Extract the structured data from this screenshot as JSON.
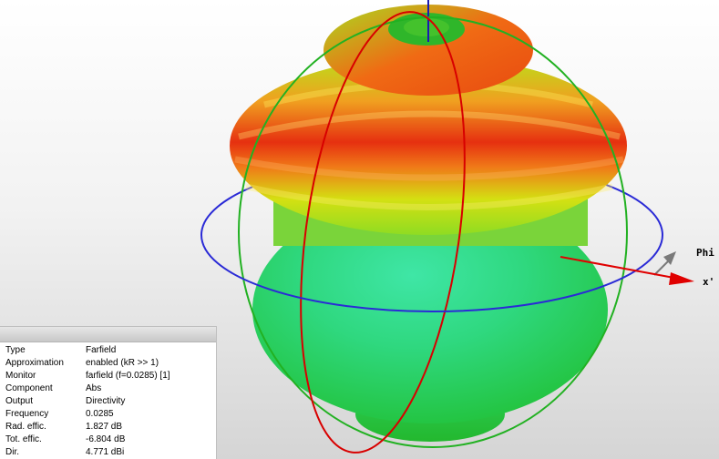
{
  "axes": {
    "phi_label": "Phi",
    "x_label": "x'"
  },
  "colors": {
    "phi_arrow": "#7a7a7a",
    "x_arrow": "#e00000",
    "ring_blue": "#2a2ad6",
    "ring_red": "#d80000",
    "ring_green": "#22b122"
  },
  "info": {
    "rows": [
      {
        "key": "Type",
        "value": "Farfield"
      },
      {
        "key": "Approximation",
        "value": "enabled (kR >> 1)"
      },
      {
        "key": "Monitor",
        "value": "farfield (f=0.0285) [1]"
      },
      {
        "key": "Component",
        "value": "Abs"
      },
      {
        "key": "Output",
        "value": "Directivity"
      },
      {
        "key": "Frequency",
        "value": "0.0285"
      },
      {
        "key": "Rad. effic.",
        "value": "1.827 dB"
      },
      {
        "key": "Tot. effic.",
        "value": "-6.804 dB"
      },
      {
        "key": "Dir.",
        "value": "4.771 dBi"
      }
    ]
  }
}
